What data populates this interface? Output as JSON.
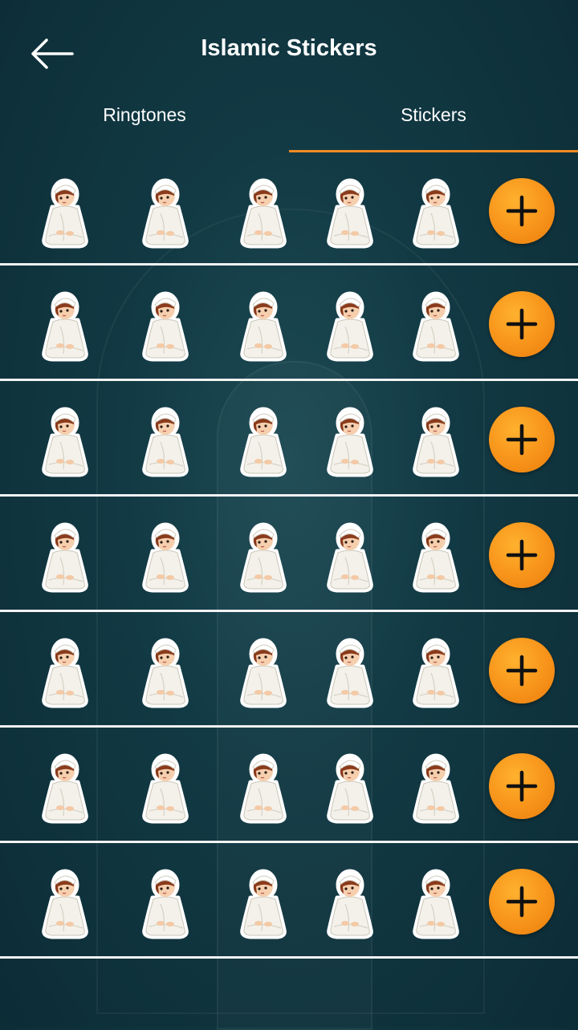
{
  "header": {
    "title": "Islamic Stickers"
  },
  "tabs": [
    {
      "label": "Ringtones",
      "active": false
    },
    {
      "label": "Stickers",
      "active": true
    }
  ],
  "rows": [
    {
      "stickers": [
        "praying-boy-sticker",
        "praying-boy-sticker",
        "praying-boy-sticker",
        "praying-boy-sticker",
        "praying-boy-sticker"
      ],
      "action": "plus-icon"
    },
    {
      "stickers": [
        "praying-boy-sticker",
        "praying-boy-sticker",
        "praying-boy-sticker",
        "praying-boy-sticker",
        "praying-boy-sticker"
      ],
      "action": "plus-icon"
    },
    {
      "stickers": [
        "praying-boy-sticker",
        "praying-boy-sticker",
        "praying-boy-sticker",
        "praying-boy-sticker",
        "praying-boy-sticker"
      ],
      "action": "plus-icon"
    },
    {
      "stickers": [
        "praying-boy-sticker",
        "praying-boy-sticker",
        "praying-boy-sticker",
        "praying-boy-sticker",
        "praying-boy-sticker"
      ],
      "action": "plus-icon"
    },
    {
      "stickers": [
        "praying-boy-sticker",
        "praying-boy-sticker",
        "praying-boy-sticker",
        "praying-boy-sticker",
        "praying-boy-sticker"
      ],
      "action": "plus-icon"
    },
    {
      "stickers": [
        "praying-boy-sticker",
        "praying-boy-sticker",
        "praying-boy-sticker",
        "praying-boy-sticker",
        "praying-boy-sticker"
      ],
      "action": "plus-icon"
    },
    {
      "stickers": [
        "praying-boy-sticker",
        "praying-boy-sticker",
        "praying-boy-sticker",
        "praying-boy-sticker",
        "praying-boy-sticker"
      ],
      "action": "plus-icon"
    }
  ],
  "colors": {
    "accent": "#f08a24",
    "background": "#123a44",
    "divider": "#f2f2f2"
  },
  "icons": {
    "back": "arrow-left-icon",
    "add": "plus-icon"
  }
}
